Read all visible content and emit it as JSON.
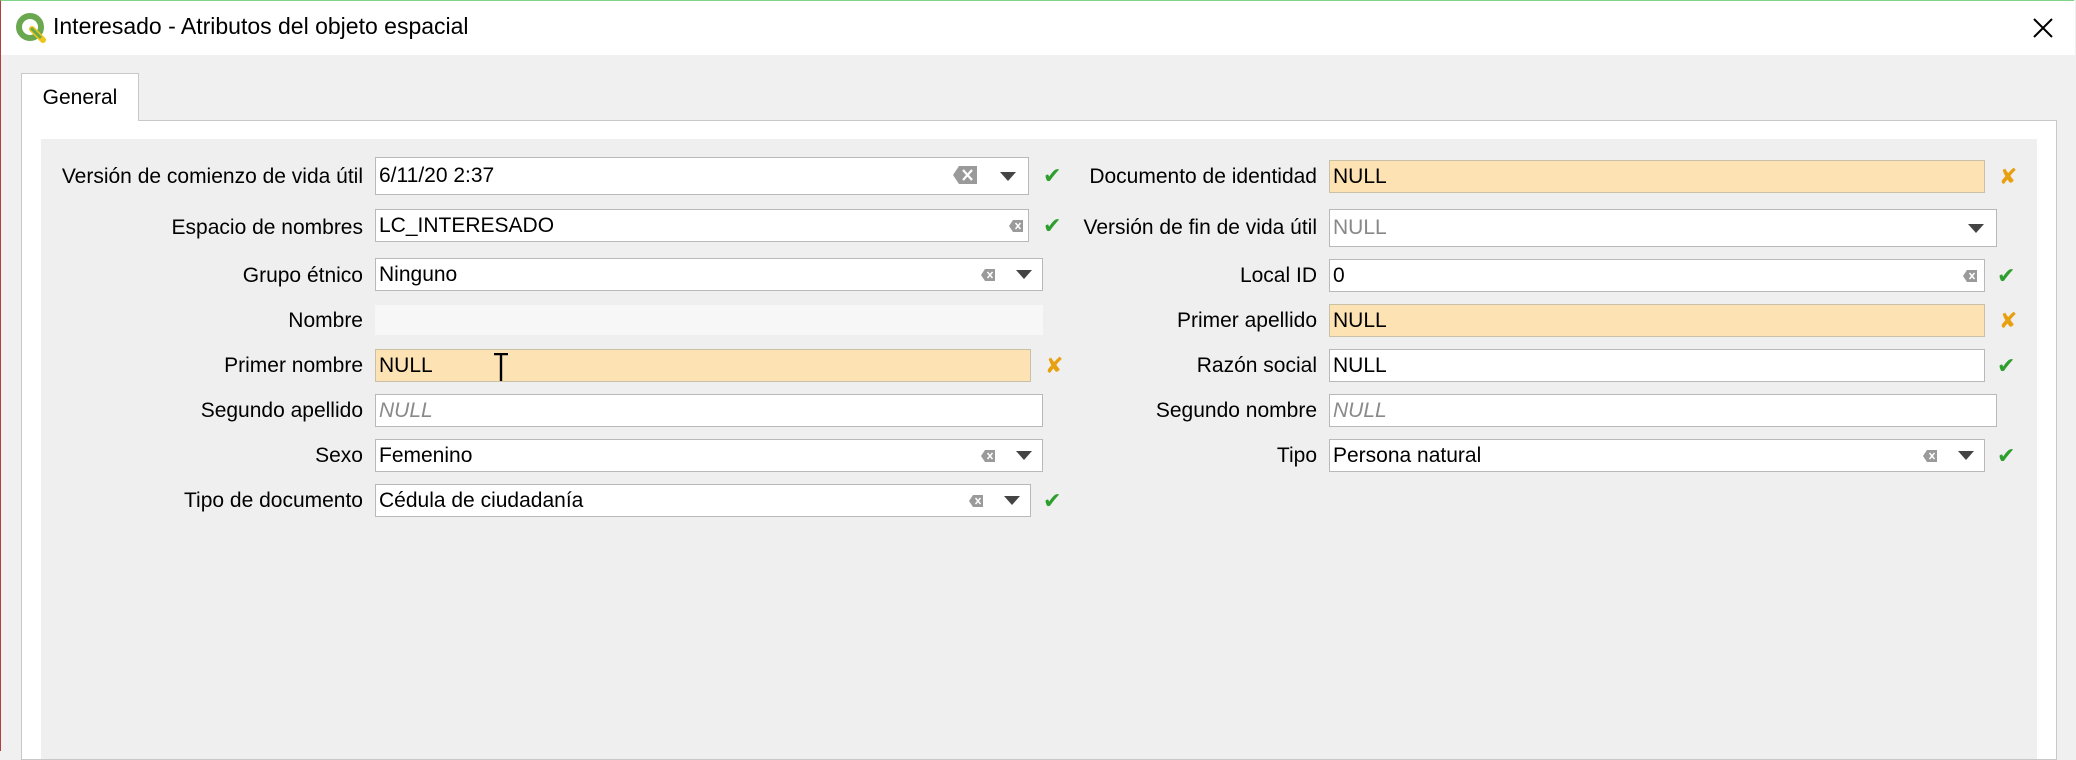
{
  "window": {
    "title": "Interesado - Atributos del objeto espacial"
  },
  "tabs": [
    {
      "label": "General"
    }
  ],
  "colors": {
    "required_bg": "#fde3b3",
    "ok": "#2e9e2e",
    "warn": "#e8a010"
  },
  "fields_left": {
    "version_inicio": {
      "label": "Versión de comienzo de vida útil",
      "value": "6/11/20 2:37",
      "status": "ok"
    },
    "espacio_nombres": {
      "label": "Espacio de nombres",
      "value": "LC_INTERESADO",
      "status": "ok"
    },
    "grupo_etnico": {
      "label": "Grupo étnico",
      "value": "Ninguno"
    },
    "nombre": {
      "label": "Nombre",
      "value": ""
    },
    "primer_nombre": {
      "label": "Primer nombre",
      "value": "NULL",
      "status": "warn"
    },
    "segundo_apellido": {
      "label": "Segundo apellido",
      "placeholder": "NULL"
    },
    "sexo": {
      "label": "Sexo",
      "value": "Femenino"
    },
    "tipo_documento": {
      "label": "Tipo de documento",
      "value": "Cédula de ciudadanía",
      "status": "ok"
    }
  },
  "fields_right": {
    "documento_identidad": {
      "label": "Documento de identidad",
      "value": "NULL",
      "status": "warn"
    },
    "version_fin": {
      "label": "Versión de fin de vida útil",
      "value": "NULL"
    },
    "local_id": {
      "label": "Local ID",
      "value": "0",
      "status": "ok"
    },
    "primer_apellido": {
      "label": "Primer apellido",
      "value": "NULL",
      "status": "warn"
    },
    "razon_social": {
      "label": "Razón social",
      "value": "NULL",
      "status": "ok"
    },
    "segundo_nombre": {
      "label": "Segundo nombre",
      "placeholder": "NULL"
    },
    "tipo": {
      "label": "Tipo",
      "value": "Persona natural",
      "status": "ok"
    }
  },
  "icons": {
    "ok": "✔",
    "warn": "✘"
  }
}
